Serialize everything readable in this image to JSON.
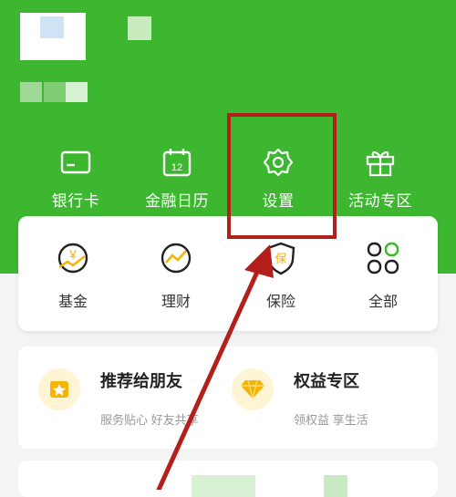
{
  "header": {
    "background": "#3cb72f"
  },
  "quick_actions": [
    {
      "label": "银行卡",
      "icon": "bank-card-icon"
    },
    {
      "label": "金融日历",
      "icon": "calendar-icon",
      "icon_text": "12"
    },
    {
      "label": "设置",
      "icon": "gear-icon"
    },
    {
      "label": "活动专区",
      "icon": "gift-icon"
    }
  ],
  "services": [
    {
      "label": "基金",
      "icon": "fund-icon",
      "icon_text": "￥"
    },
    {
      "label": "理财",
      "icon": "wealth-icon"
    },
    {
      "label": "保险",
      "icon": "insurance-icon",
      "icon_text": "保"
    },
    {
      "label": "全部",
      "icon": "grid-icon"
    }
  ],
  "promos": [
    {
      "title": "推荐给朋友",
      "subtitle": "服务贴心 好友共享",
      "icon": "star-badge-icon",
      "color": "#f5b400"
    },
    {
      "title": "权益专区",
      "subtitle": "领权益 享生活",
      "icon": "diamond-icon",
      "color": "#f5b400"
    }
  ],
  "annotation": {
    "color": "#b3201c"
  }
}
